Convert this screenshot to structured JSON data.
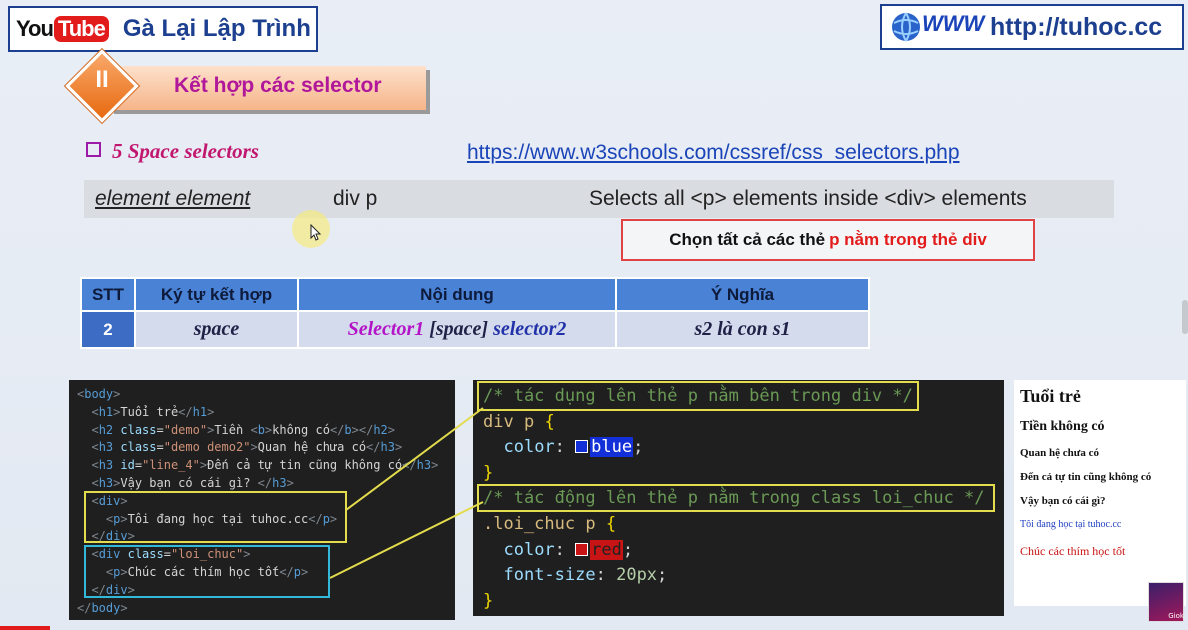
{
  "header": {
    "youtube_you": "You",
    "youtube_tube": "Tube",
    "channel_name": "Gà Lại Lập Trình",
    "site_url": "http://tuhoc.cc",
    "www_text": "WWW"
  },
  "section": {
    "number": "II",
    "title": "Kết hợp các selector"
  },
  "subheading": {
    "bullet": "❑",
    "title": "5  Space selectors",
    "link": "https://www.w3schools.com/cssref/css_selectors.php"
  },
  "selector_row": {
    "selector": "element element",
    "example": "div p",
    "description": "Selects all <p> elements inside <div> elements"
  },
  "note": {
    "prefix": "Chọn tất cả các thẻ",
    "highlight": "p nằm trong thẻ div"
  },
  "table": {
    "headers": [
      "STT",
      "Ký tự kết hợp",
      "Nội dung",
      "Ý Nghĩa"
    ],
    "row": {
      "stt": "2",
      "char": "space",
      "content_a": "Selector1",
      "content_b": "[space]",
      "content_c": "selector2",
      "meaning": "s2 là con s1"
    }
  },
  "html_code": {
    "tags": {
      "body": "body",
      "h1": "h1",
      "h2": "h2",
      "h3": "h3",
      "b": "b",
      "div": "div",
      "p": "p"
    },
    "attrs": {
      "class": "class",
      "id": "id"
    },
    "values": {
      "demo": "\"demo\"",
      "demo2": "\"demo demo2\"",
      "line4": "\"line_4\"",
      "loi_chuc": "\"loi_chuc\""
    },
    "texts": {
      "h1": "Tuổi trẻ",
      "h2": "Tiền ",
      "b": "không có",
      "h3a": "Quan hệ chưa có",
      "h3b": "Đến cả tự tin cũng không có",
      "h3c": "Vậy bạn có cái gì? ",
      "p1": "Tôi đang học tại tuhoc.cc",
      "p2": "Chúc các thím học tốt"
    }
  },
  "css_code": {
    "comment1": "/* tác dụng lên thẻ p nằm bên trong div */",
    "selector1": "div p",
    "brace_open": "{",
    "brace_close": "}",
    "prop_color": "color",
    "value_blue": "blue",
    "comment2": "/* tác động lên thẻ p nằm trong class loi_chuc */",
    "selector2": ".loi_chuc p",
    "value_red": "red",
    "prop_font_size": "font-size",
    "value_font_size": "20px"
  },
  "preview": {
    "h1": "Tuổi trẻ",
    "h2": "Tiền không có",
    "h3a": "Quan hệ chưa có",
    "h3b": "Đến cả tự tin cũng không có",
    "h3c": "Vậy bạn có cái gì?",
    "p1": "Tôi đang học tại tuhoc.cc",
    "p2": "Chúc các thím học tốt"
  },
  "avatar": {
    "label": "Giok"
  },
  "colors": {
    "accent_blue": "#1d3f8f",
    "link_blue": "#1a44b8",
    "highlight_red": "#e21b1b",
    "table_header": "#4a82d6",
    "highlight_yellow": "#e3dc4c",
    "highlight_cyan": "#32b8d8"
  }
}
